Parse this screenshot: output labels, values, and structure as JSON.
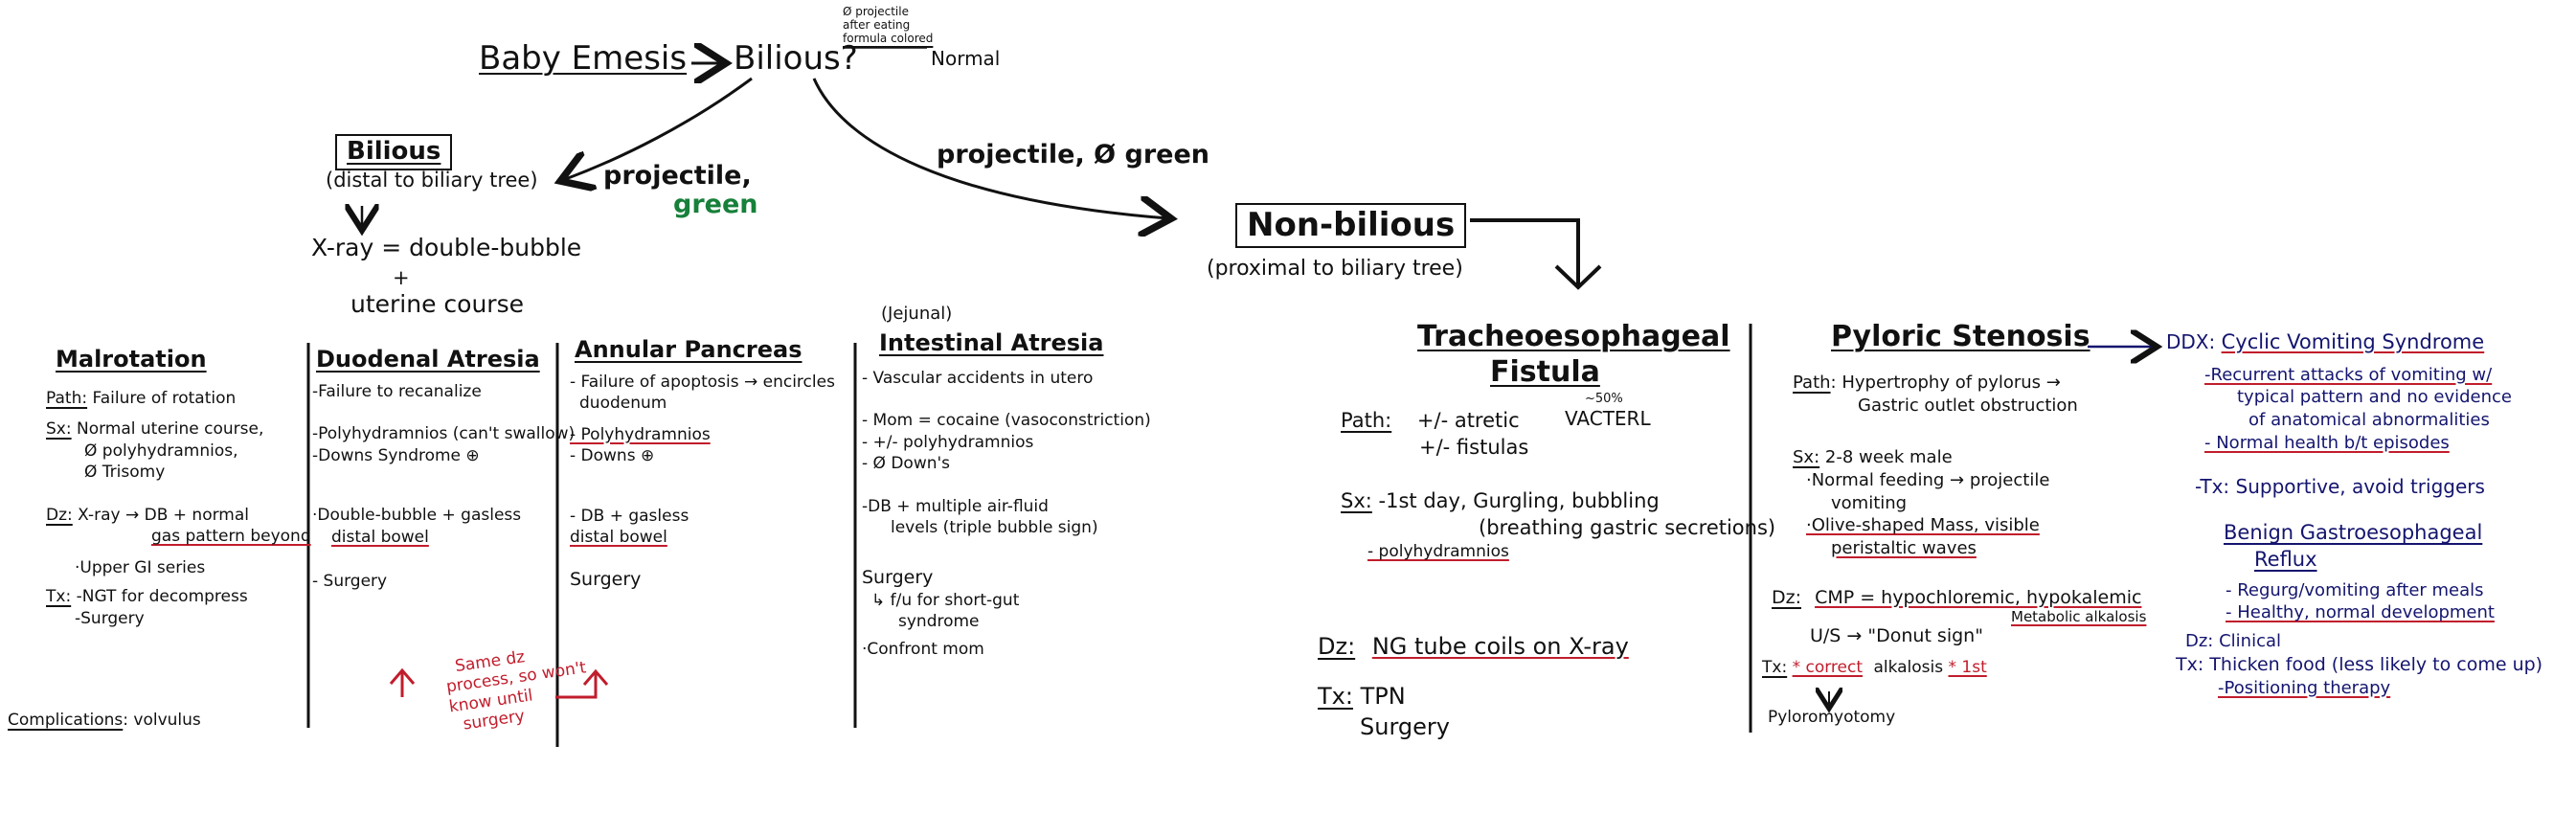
{
  "root": {
    "title": "Baby Emesis",
    "question": "Bilious?",
    "normal_conditions": [
      "Ø projectile",
      "after eating",
      "formula colored"
    ],
    "normal_label": "Normal",
    "branch_left_label": "projectile,",
    "branch_left_label_green": "green",
    "branch_right_label": "projectile, Ø green"
  },
  "bilious": {
    "title": "Bilious",
    "subtitle": "(distal to biliary tree)",
    "xray_line": "X-ray = double-bubble",
    "plus": "+",
    "course_line": "uterine course"
  },
  "nonbilious": {
    "title": "Non-bilious",
    "subtitle": "(proximal to biliary tree)"
  },
  "malrotation": {
    "title": "Malrotation",
    "path_label": "Path:",
    "path_text": "Failure of rotation",
    "sx_label": "Sx:",
    "sx_lines": [
      "Normal uterine course,",
      "Ø polyhydramnios,",
      "Ø Trisomy"
    ],
    "dz_label": "Dz:",
    "dz_lines": [
      "X-ray → DB + normal",
      "gas pattern beyond",
      "·Upper GI series"
    ],
    "tx_label": "Tx:",
    "tx_lines": [
      "-NGT for decompress",
      "-Surgery"
    ],
    "complications_label": "Complications",
    "complications_text": ": volvulus"
  },
  "duodenal": {
    "title": "Duodenal Atresia",
    "lines": [
      "-Failure to recanalize",
      "-Polyhydramnios (can't swallow)",
      "-Downs Syndrome ⊕",
      "·Double-bubble + gasless",
      "distal bowel",
      "- Surgery"
    ]
  },
  "annular": {
    "title": "Annular Pancreas",
    "lines": [
      "- Failure of apoptosis → encircles",
      "duodenum",
      "- Polyhydramnios",
      "- Downs ⊕",
      "- DB + gasless",
      "distal bowel",
      "Surgery"
    ]
  },
  "same_dz_note": [
    "Same dz",
    "process, so won't",
    "know until",
    "surgery"
  ],
  "intestinal": {
    "pre_title": "(Jejunal)",
    "title": "Intestinal Atresia",
    "lines": [
      "- Vascular accidents in utero",
      "- Mom = cocaine (vasoconstriction)",
      "- +/- polyhydramnios",
      "- Ø Down's",
      "-DB + multiple air-fluid",
      "levels (triple bubble sign)",
      "Surgery",
      "↳ f/u for short-gut",
      "syndrome",
      "·Confront mom"
    ]
  },
  "te_fistula": {
    "title_line1": "Tracheoesophageal",
    "title_line2": "Fistula",
    "path_label": "Path:",
    "path_lines": [
      "+/- atretic",
      "+/- fistulas"
    ],
    "vacterl_pct": "~50%",
    "vacterl": "VACTERL",
    "sx_label": "Sx:",
    "sx_lines": [
      "-1st day, Gurgling, bubbling",
      "(breathing gastric secretions)",
      "- polyhydramnios"
    ],
    "dz_label": "Dz:",
    "dz_text": "NG tube coils on X-ray",
    "tx_label": "Tx:",
    "tx_lines": [
      "TPN",
      "Surgery"
    ]
  },
  "pyloric": {
    "title": "Pyloric Stenosis",
    "path_label": "Path",
    "path_lines": [
      ": Hypertrophy of pylorus →",
      "Gastric outlet obstruction"
    ],
    "sx_label": "Sx:",
    "sx_lines": [
      "2-8 week male",
      "·Normal feeding → projectile",
      "vomiting",
      "·Olive-shaped Mass, visible",
      "peristaltic waves"
    ],
    "dz_label": "Dz:",
    "dz_lines": [
      "CMP = hypochloremic, hypokalemic",
      "Metabolic alkalosis",
      "U/S → \"Donut sign\""
    ],
    "tx_label": "Tx:",
    "tx_text_correct": "* correct",
    "tx_text_alkalosis": "alkalosis",
    "tx_text_first": "* 1st",
    "tx_result": "Pyloromyotomy"
  },
  "ddx": {
    "label": "DDX:",
    "cvs_title": "Cyclic Vomiting Syndrome",
    "cvs_lines": [
      "-Recurrent attacks of vomiting w/",
      "typical pattern and no evidence",
      "of anatomical abnormalities",
      "- Normal health b/t episodes",
      "-Tx: Supportive, avoid triggers"
    ],
    "gerd_title_line1": "Benign Gastroesophageal",
    "gerd_title_line2": "Reflux",
    "gerd_lines": [
      "- Regurg/vomiting after meals",
      "- Healthy, normal development",
      "Dz: Clinical",
      "Tx: Thicken food (less likely to come up)",
      "-Positioning therapy"
    ]
  },
  "colors": {
    "ink": "#111111",
    "red": "#c11d2c",
    "green": "#17803a",
    "navy": "#14156e"
  }
}
